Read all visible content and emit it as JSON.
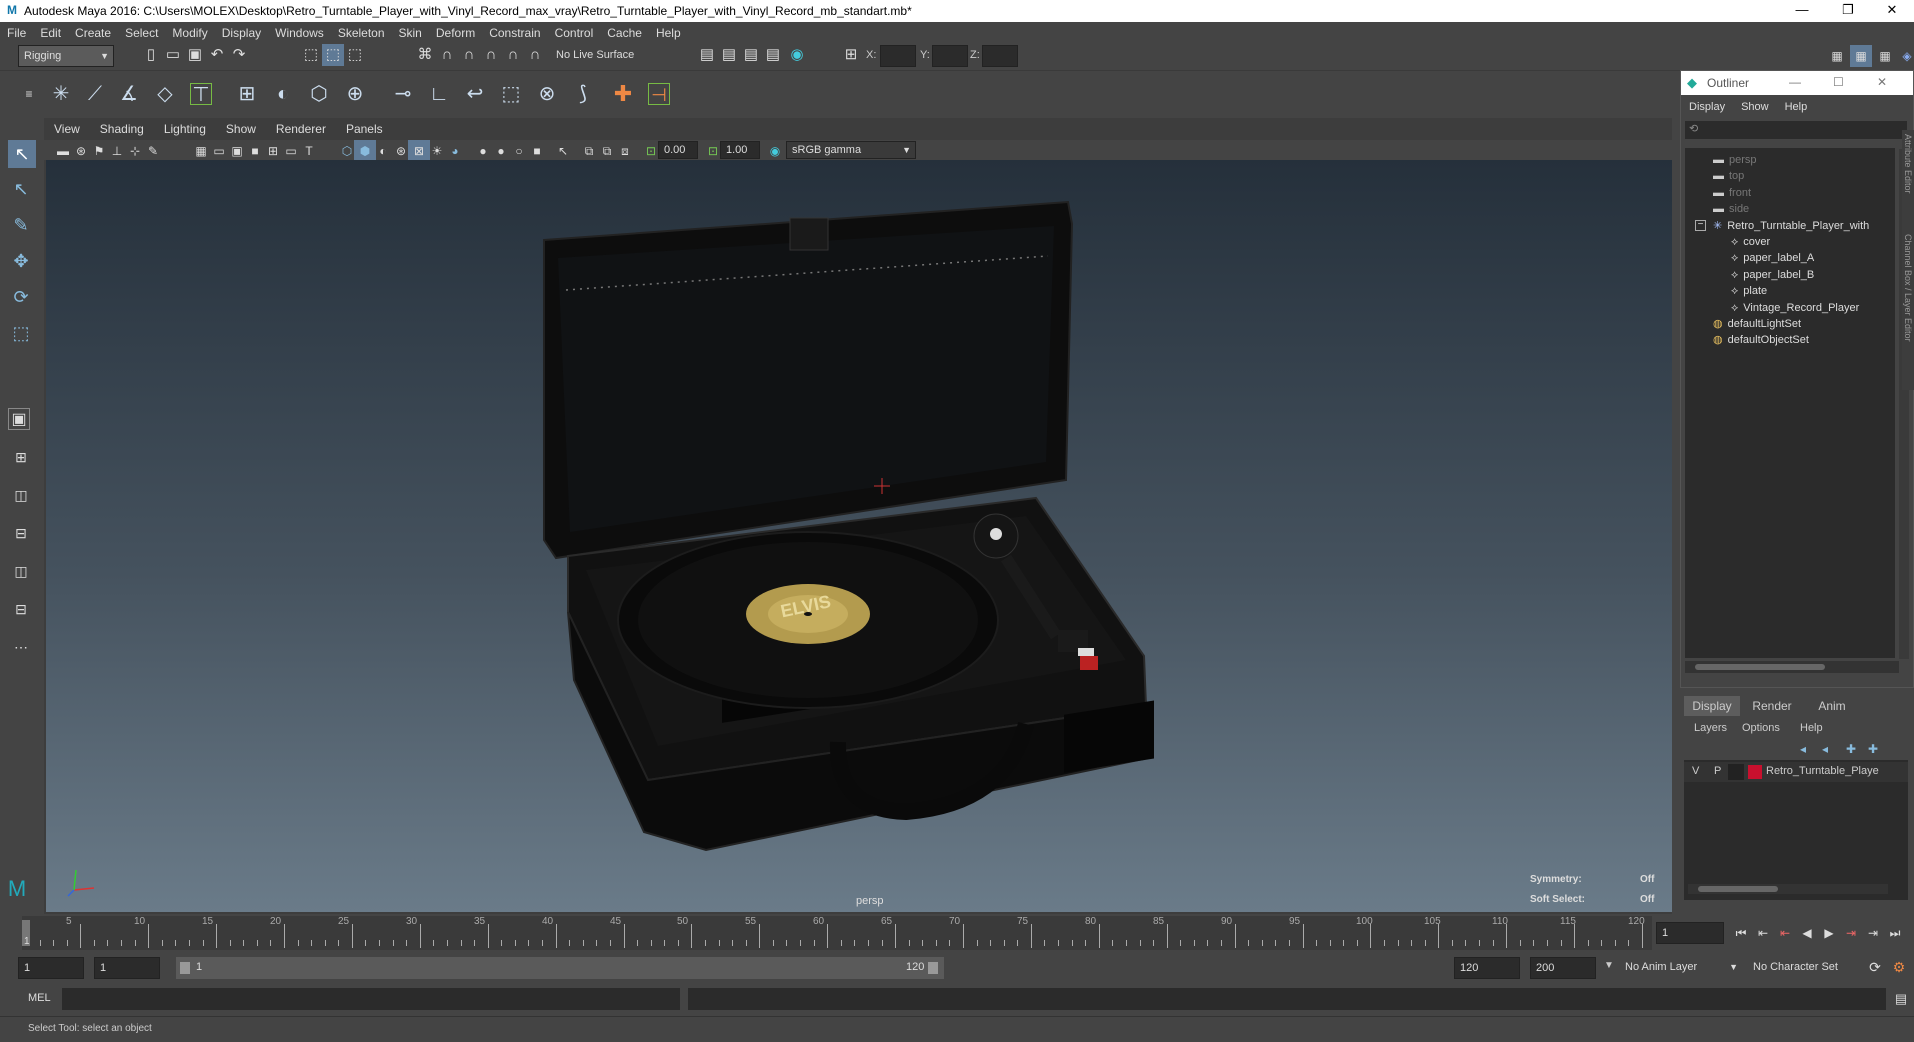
{
  "window": {
    "title": "Autodesk Maya 2016: C:\\Users\\MOLEX\\Desktop\\Retro_Turntable_Player_with_Vinyl_Record_max_vray\\Retro_Turntable_Player_with_Vinyl_Record_mb_standart.mb*"
  },
  "menu": [
    "File",
    "Edit",
    "Create",
    "Select",
    "Modify",
    "Display",
    "Windows",
    "Skeleton",
    "Skin",
    "Deform",
    "Constrain",
    "Control",
    "Cache",
    "Help"
  ],
  "toolbar": {
    "mode": "Rigging",
    "live_surface": "No Live Surface",
    "x_label": "X:",
    "y_label": "Y:",
    "z_label": "Z:"
  },
  "viewport": {
    "menu": [
      "View",
      "Shading",
      "Lighting",
      "Show",
      "Renderer",
      "Panels"
    ],
    "near": "0.00",
    "far": "1.00",
    "color_space": "sRGB gamma",
    "camera": "persp",
    "hud": [
      {
        "label": "Symmetry:",
        "value": "Off"
      },
      {
        "label": "Soft Select:",
        "value": "Off"
      }
    ],
    "record_label": "ELVIS"
  },
  "outliner": {
    "title": "Outliner",
    "menu": [
      "Display",
      "Show",
      "Help"
    ],
    "items": [
      {
        "name": "persp",
        "dim": true,
        "level": 1,
        "icon": "camera-icon"
      },
      {
        "name": "top",
        "dim": true,
        "level": 1,
        "icon": "camera-icon"
      },
      {
        "name": "front",
        "dim": true,
        "level": 1,
        "icon": "camera-icon"
      },
      {
        "name": "side",
        "dim": true,
        "level": 1,
        "icon": "camera-icon"
      },
      {
        "name": "Retro_Turntable_Player_with",
        "dim": false,
        "level": 1,
        "icon": "group-icon"
      },
      {
        "name": "cover",
        "dim": false,
        "level": 2,
        "icon": "mesh-icon"
      },
      {
        "name": "paper_label_A",
        "dim": false,
        "level": 2,
        "icon": "mesh-icon"
      },
      {
        "name": "paper_label_B",
        "dim": false,
        "level": 2,
        "icon": "mesh-icon"
      },
      {
        "name": "plate",
        "dim": false,
        "level": 2,
        "icon": "mesh-icon"
      },
      {
        "name": "Vintage_Record_Player",
        "dim": false,
        "level": 2,
        "icon": "mesh-icon"
      },
      {
        "name": "defaultLightSet",
        "dim": false,
        "level": 1,
        "icon": "set-icon"
      },
      {
        "name": "defaultObjectSet",
        "dim": false,
        "level": 1,
        "icon": "set-icon"
      }
    ]
  },
  "side_tabs": [
    "Attribute Editor",
    "Channel Box / Layer Editor"
  ],
  "layers": {
    "tabs": [
      "Display",
      "Render",
      "Anim"
    ],
    "menu": [
      "Layers",
      "Options",
      "Help"
    ],
    "layer": {
      "v": "V",
      "p": "P",
      "name": "Retro_Turntable_Playe",
      "color": "#c8102e"
    }
  },
  "timeline": {
    "ticks": [
      "5",
      "10",
      "15",
      "20",
      "25",
      "30",
      "35",
      "40",
      "45",
      "50",
      "55",
      "60",
      "65",
      "70",
      "75",
      "80",
      "85",
      "90",
      "95",
      "100",
      "105",
      "110",
      "115",
      "120"
    ],
    "start_mark": "1",
    "current_frame": "1"
  },
  "range": {
    "start": "1",
    "playback_start": "1",
    "slider_start": "1",
    "slider_end": "120",
    "playback_end": "120",
    "end": "200",
    "anim_layer": "No Anim Layer",
    "char_set": "No Character Set"
  },
  "cmd": {
    "lang": "MEL"
  },
  "help_text": "Select Tool: select an object"
}
